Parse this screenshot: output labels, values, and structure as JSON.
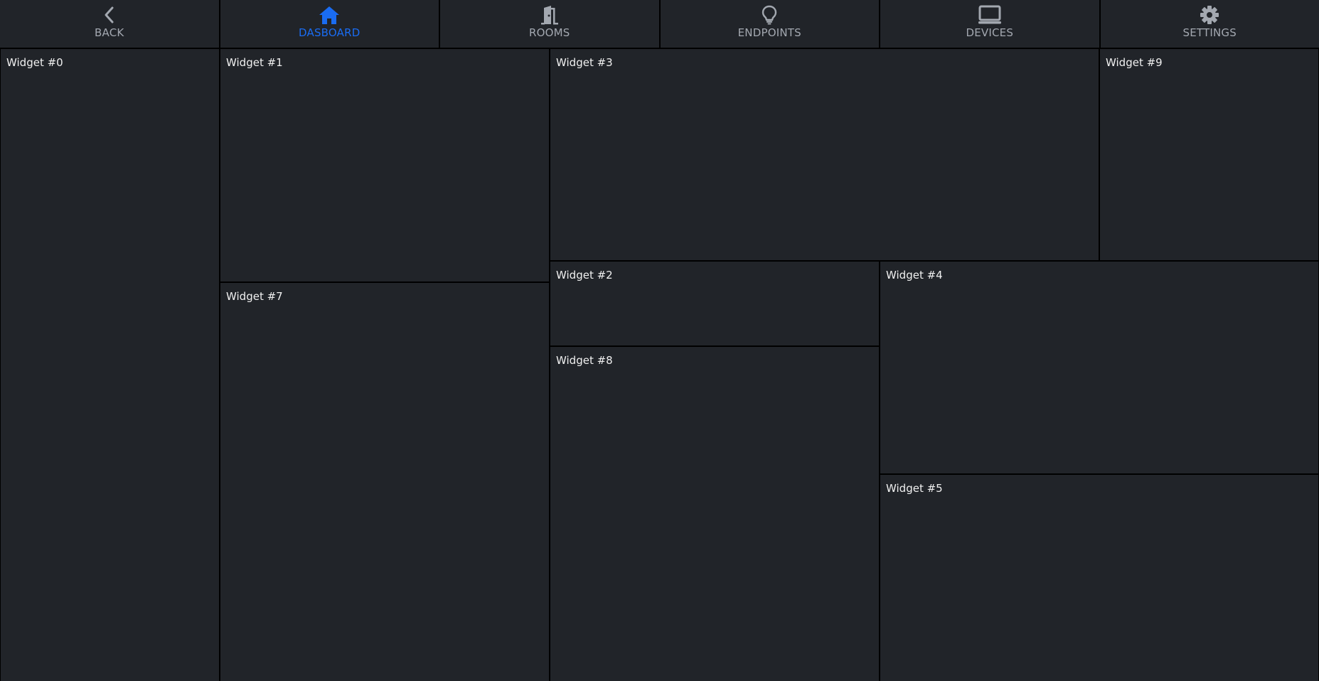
{
  "nav": {
    "items": [
      {
        "label": "BACK",
        "icon": "chevron-left-icon",
        "active": false
      },
      {
        "label": "DASBOARD",
        "icon": "home-icon",
        "active": true
      },
      {
        "label": "ROOMS",
        "icon": "door-icon",
        "active": false
      },
      {
        "label": "ENDPOINTS",
        "icon": "lightbulb-icon",
        "active": false
      },
      {
        "label": "DEVICES",
        "icon": "monitor-icon",
        "active": false
      },
      {
        "label": "SETTINGS",
        "icon": "gear-icon",
        "active": false
      }
    ],
    "colors": {
      "active": "#1a6cf2",
      "inactive": "#a3a8b0",
      "background": "#212429"
    }
  },
  "widgets": {
    "w0": {
      "title": "Widget #0"
    },
    "w1": {
      "title": "Widget #1"
    },
    "w2": {
      "title": "Widget #2"
    },
    "w3": {
      "title": "Widget #3"
    },
    "w4": {
      "title": "Widget #4"
    },
    "w5": {
      "title": "Widget #5"
    },
    "w7": {
      "title": "Widget #7"
    },
    "w8": {
      "title": "Widget #8"
    },
    "w9": {
      "title": "Widget #9"
    }
  }
}
